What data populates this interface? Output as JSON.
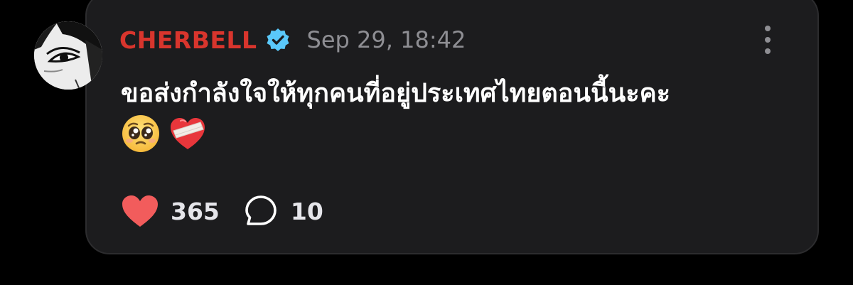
{
  "post": {
    "username": "CHERBELL",
    "verified": true,
    "timestamp": "Sep 29, 18:42",
    "message": "ขอส่งกำลังใจให้ทุกคนที่อยู่ประเทศไทยตอนนี้นะคะ",
    "emojis": [
      "pleading-face",
      "mending-heart"
    ],
    "likes": "365",
    "comments": "10"
  },
  "icons": {
    "avatar": "avatar-illustration",
    "verified": "verified-badge-icon",
    "more": "more-vertical-icon",
    "like": "heart-icon",
    "comment": "comment-bubble-icon"
  },
  "colors": {
    "background": "#000000",
    "card": "#1c1c1e",
    "username": "#d8352d",
    "verified_badge": "#5ac8fa",
    "timestamp": "#8e8e93",
    "message": "#ffffff",
    "like_heart": "#f25c5c",
    "counts": "#e5e5ea"
  }
}
